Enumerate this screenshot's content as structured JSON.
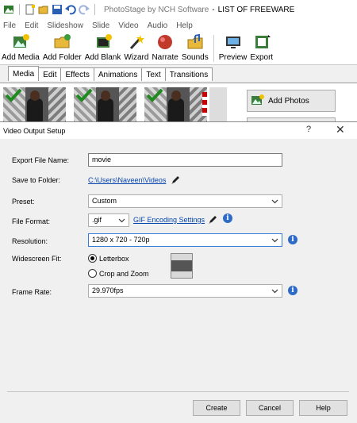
{
  "app": {
    "name": "PhotoStage by NCH Software",
    "document": "LIST OF FREEWARE"
  },
  "menu": [
    "File",
    "Edit",
    "Slideshow",
    "Slide",
    "Video",
    "Audio",
    "Help"
  ],
  "toolbar": {
    "add_media": "Add Media",
    "add_folder": "Add Folder",
    "add_blank": "Add Blank",
    "wizard": "Wizard",
    "narrate": "Narrate",
    "sounds": "Sounds",
    "preview": "Preview",
    "export": "Export"
  },
  "tabs": [
    "Media",
    "Edit",
    "Effects",
    "Animations",
    "Text",
    "Transitions"
  ],
  "media_panel": {
    "add_photos": "Add Photos"
  },
  "dialog": {
    "title": "Video Output Setup",
    "help_glyph": "?",
    "close_glyph": "✕",
    "export_file_name_label": "Export File Name:",
    "export_file_name_value": "movie",
    "save_to_folder_label": "Save to Folder:",
    "save_to_folder_value": "C:\\Users\\Naveen\\Videos",
    "preset_label": "Preset:",
    "preset_value": "Custom",
    "file_format_label": "File Format:",
    "file_format_value": ".gif",
    "gif_settings_link": "GIF Encoding Settings",
    "resolution_label": "Resolution:",
    "resolution_value": "1280 x 720 - 720p",
    "widescreen_label": "Widescreen Fit:",
    "letterbox_label": "Letterbox",
    "crop_zoom_label": "Crop and Zoom",
    "frame_rate_label": "Frame Rate:",
    "frame_rate_value": "29.970fps",
    "info_glyph": "i",
    "create_button": "Create",
    "cancel_button": "Cancel",
    "help_button": "Help"
  },
  "colors": {
    "link": "#0645ad",
    "info": "#2d6bc7",
    "focus_border": "#3879d9"
  }
}
